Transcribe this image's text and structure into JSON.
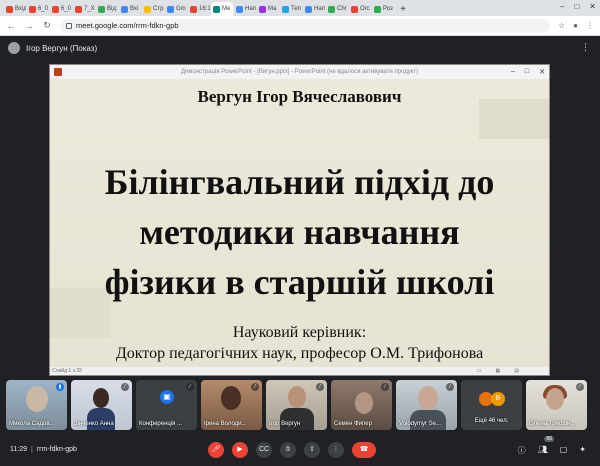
{
  "browser": {
    "tabs": [
      {
        "label": "Вхід",
        "color": "#ea4335"
      },
      {
        "label": "6_0",
        "color": "#ea4335"
      },
      {
        "label": "6_0",
        "color": "#ea4335"
      },
      {
        "label": "7_X",
        "color": "#ea4335"
      },
      {
        "label": "Від:",
        "color": "#34a853"
      },
      {
        "label": "Вхі",
        "color": "#4285f4"
      },
      {
        "label": "Стр",
        "color": "#fbbc04"
      },
      {
        "label": "Gm",
        "color": "#4285f4"
      },
      {
        "label": "16:1",
        "color": "#ea4335"
      },
      {
        "label": "Ме",
        "color": "#00897b",
        "active": true
      },
      {
        "label": "Нап",
        "color": "#4285f4"
      },
      {
        "label": "Ма",
        "color": "#9334e6"
      },
      {
        "label": "Теп",
        "color": "#26a5e4"
      },
      {
        "label": "Нап",
        "color": "#4285f4"
      },
      {
        "label": "Chr",
        "color": "#34a853"
      },
      {
        "label": "Orc",
        "color": "#ea4335"
      },
      {
        "label": "Роз",
        "color": "#34a853"
      }
    ],
    "new_tab": "+",
    "url": "meet.google.com/rrm-fdkn-gpb"
  },
  "meet": {
    "presenter_label": "Ігор Вергун (Показ)",
    "ppt_title": "Демонстрація PowerPoint - [Вигун.pptx] - PowerPoint (не вдалося активувати продукт)",
    "slide": {
      "author": "Вергун Ігор Вячеславович",
      "topic_line1": "Білінгвальний підхід до",
      "topic_line2": "методики навчання",
      "topic_line3": "фізики в старшій школі",
      "advisor_label": "Науковий керівник:",
      "advisor_name": "Доктор педагогічних наук, професор О.М. Трифонова",
      "slide_counter": "Слайд 1 з 32"
    },
    "tiles": [
      {
        "name": "Микола Садов...",
        "mic": "on"
      },
      {
        "name": "Зінченко Анна",
        "mic": "off"
      },
      {
        "name": "Конференція ...",
        "mic": "off"
      },
      {
        "name": "Ірина Володи...",
        "mic": "off"
      },
      {
        "name": "Ігор Вергун",
        "mic": "off"
      },
      {
        "name": "Семен Фипер",
        "mic": "off"
      },
      {
        "name": "Volodymyr Se...",
        "mic": "off"
      },
      {
        "name": "Ещё 46 чел.",
        "avatar_letter": "В"
      },
      {
        "name": "Олена Трифон...",
        "mic": "off"
      }
    ],
    "bottom": {
      "time": "11:29",
      "separator": "|",
      "meeting_code": "rrm-fdkn-gpb",
      "people_count": "56"
    }
  }
}
